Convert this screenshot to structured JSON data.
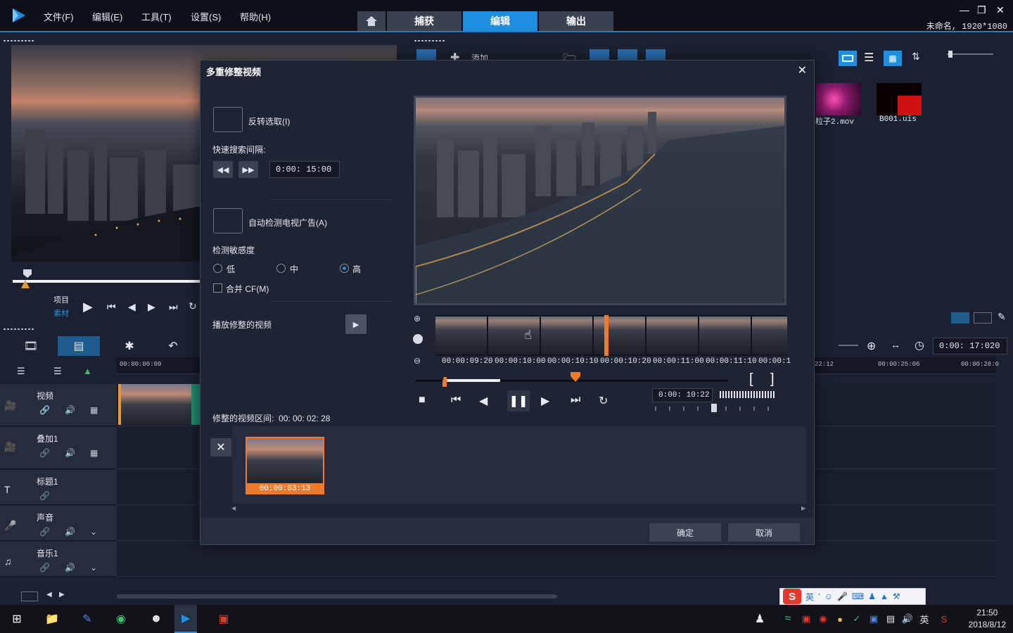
{
  "app": {
    "menu": [
      "文件(F)",
      "编辑(E)",
      "工具(T)",
      "设置(S)",
      "帮助(H)"
    ],
    "tabs": [
      {
        "label": "捕获",
        "active": false
      },
      {
        "label": "编辑",
        "active": true
      },
      {
        "label": "输出",
        "active": false
      }
    ],
    "project_info": "未命名, 1920*1080",
    "accent_color": "#1e8fe0"
  },
  "player": {
    "project_label": "项目",
    "clip_label": "素材"
  },
  "library": {
    "add_label": "添加",
    "items": [
      {
        "caption": "粒子2.mov",
        "icon": "video-file-icon"
      },
      {
        "caption": "B001.uis",
        "icon": "template-file-icon"
      }
    ]
  },
  "timeline": {
    "timecode": "0:00: 17:020",
    "ruler": [
      "00:00:00:00",
      "22:12",
      "00:00:25:06",
      "00:00:28:0"
    ],
    "tracks": [
      {
        "name": "视频",
        "icon": "video-track-icon"
      },
      {
        "name": "叠加1",
        "icon": "overlay-track-icon"
      },
      {
        "name": "标题1",
        "icon": "title-track-icon"
      },
      {
        "name": "声音",
        "icon": "voice-track-icon"
      },
      {
        "name": "音乐1",
        "icon": "music-track-icon"
      }
    ]
  },
  "dialog": {
    "title": "多重修整视频",
    "reverse_select": "反转选取(I)",
    "fast_search_interval": "快速搜索间隔:",
    "interval_value": "0:00: 15:00",
    "auto_detect": "自动检测电视广告(A)",
    "sensitivity_label": "检测敏感度",
    "sensitivity": [
      {
        "label": "低",
        "checked": false
      },
      {
        "label": "中",
        "checked": false
      },
      {
        "label": "高",
        "checked": true
      }
    ],
    "merge_cf": "合并 CF(M)",
    "play_trimmed": "播放修整的视频",
    "filmstrip_times": [
      "00:00:09:20",
      "00:00:10:00",
      "00:00:10:10",
      "00:00:10:20",
      "00:00:11:00",
      "00:00:11:10",
      "00:00:1"
    ],
    "current_timecode": "0:00: 10:22",
    "trim_range_label": "修整的视频区间:",
    "trim_range_value": "00: 00: 02: 28",
    "clip_duration": "00:00:03:13",
    "ok": "确定",
    "cancel": "取消",
    "mark_in": "[",
    "mark_out": "]"
  },
  "ime": {
    "logo": "S",
    "lang": "英"
  },
  "taskbar": {
    "lang": "英",
    "time": "21:50",
    "date": "2018/8/12"
  }
}
